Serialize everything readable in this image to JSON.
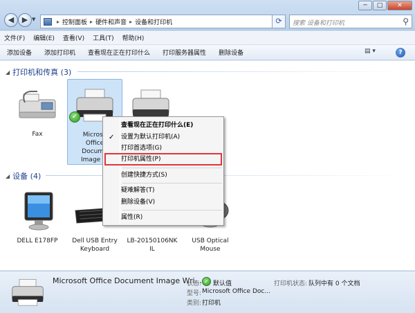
{
  "window": {
    "minimize": "─",
    "maximize": "□",
    "close": "✕"
  },
  "breadcrumb": [
    "控制面板",
    "硬件和声音",
    "设备和打印机"
  ],
  "search": {
    "placeholder": "搜索 设备和打印机"
  },
  "menubar": [
    "文件(F)",
    "编辑(E)",
    "查看(V)",
    "工具(T)",
    "帮助(H)"
  ],
  "commands": [
    "添加设备",
    "添加打印机",
    "查看现在正在打印什么",
    "打印服务器属性",
    "删除设备"
  ],
  "groups": {
    "printers": {
      "title": "打印机和传真 (3)"
    },
    "devices": {
      "title": "设备 (4)"
    }
  },
  "printers": [
    {
      "label": "Fax"
    },
    {
      "label": "Microsoft Office Document Image W..."
    },
    {
      "label": ""
    }
  ],
  "devices": [
    {
      "label": "DELL E178FP"
    },
    {
      "label": "Dell USB Entry Keyboard"
    },
    {
      "label": "LB-20150106NK IL"
    },
    {
      "label": "USB Optical Mouse"
    }
  ],
  "printer_partial": {
    "line1": "Microso",
    "line2": "Office",
    "line3": "Docume",
    "line4": "Image W"
  },
  "device_partial": {
    "line1": "LB-20150106NK",
    "line2": "IL"
  },
  "context_menu": {
    "items": [
      "查看现在正在打印什么(E)",
      "设置为默认打印机(A)",
      "打印首选项(G)",
      "打印机属性(P)",
      "创建快捷方式(S)",
      "疑难解答(T)",
      "删除设备(V)",
      "属性(R)"
    ],
    "checkmark": "✓"
  },
  "details": {
    "name": "Microsoft Office Document Image Wri...",
    "status_key": "状态:",
    "status_val": "默认值",
    "model_key": "型号:",
    "model_val": "Microsoft Office Doc...",
    "category_key": "类别:",
    "category_val": "打印机",
    "printer_status_key": "打印机状态:",
    "printer_status_val": "队列中有 0 个文档"
  },
  "colors": {
    "group_title": "#1e3f8c",
    "highlight": "#e0353a",
    "selection": "#cde3f8"
  }
}
